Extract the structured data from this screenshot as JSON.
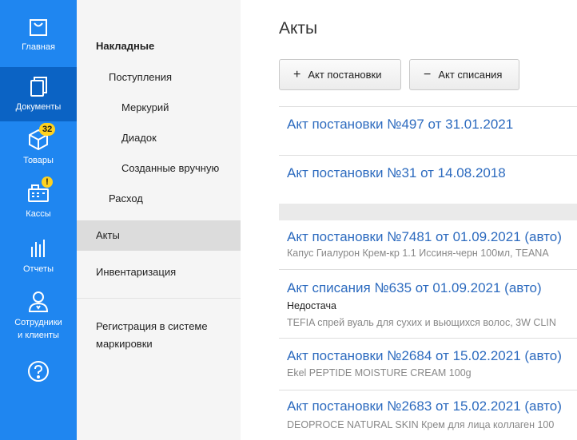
{
  "nav": {
    "items": [
      {
        "label": "Главная",
        "icon": "bag-icon"
      },
      {
        "label": "Документы",
        "icon": "documents-icon"
      },
      {
        "label": "Товары",
        "icon": "box-icon",
        "badge": "32"
      },
      {
        "label": "Кассы",
        "icon": "cash-register-icon",
        "badge": "!"
      },
      {
        "label": "Отчеты",
        "icon": "bar-chart-icon"
      },
      {
        "label": "Сотрудники",
        "label2": "и клиенты",
        "icon": "person-icon"
      },
      {
        "label": "",
        "icon": "help-icon"
      }
    ],
    "active_index": 1
  },
  "submenu": {
    "section": "Накладные",
    "items": [
      "Поступления",
      "Меркурий",
      "Диадок",
      "Созданные вручную",
      "Расход",
      "Акты",
      "Инвентаризация"
    ],
    "marking": [
      "Регистрация в системе",
      "маркировки"
    ]
  },
  "main": {
    "title": "Акты",
    "btn_add": "Акт постановки",
    "btn_remove": "Акт списания",
    "rows": [
      {
        "title": "Акт постановки №497 от 31.01.2021"
      },
      {
        "title": "Акт постановки №31 от 14.08.2018"
      },
      {
        "title": "Акт постановки №7481 от 01.09.2021 (авто)",
        "subtitle": "Капус Гиалурон Крем-кр 1.1 Иссиня-черн 100мл, TEANA"
      },
      {
        "title": "Акт списания №635 от 01.09.2021 (авто)",
        "note": "Недостача",
        "subtitle": "TEFIA спрей вуаль для сухих и вьющихся волос, 3W CLIN"
      },
      {
        "title": "Акт постановки №2684 от 15.02.2021 (авто)",
        "subtitle": "Ekel PEPTIDE MOISTURE CREAM 100g"
      },
      {
        "title": "Акт постановки №2683 от 15.02.2021 (авто)",
        "subtitle": "DEOPROCE NATURAL SKIN Крем для лица коллаген 100"
      }
    ]
  },
  "colors": {
    "nav_bg": "#1f86f0",
    "nav_active": "#0b63c4",
    "link": "#2d6bbf",
    "badge": "#ffd21f"
  }
}
